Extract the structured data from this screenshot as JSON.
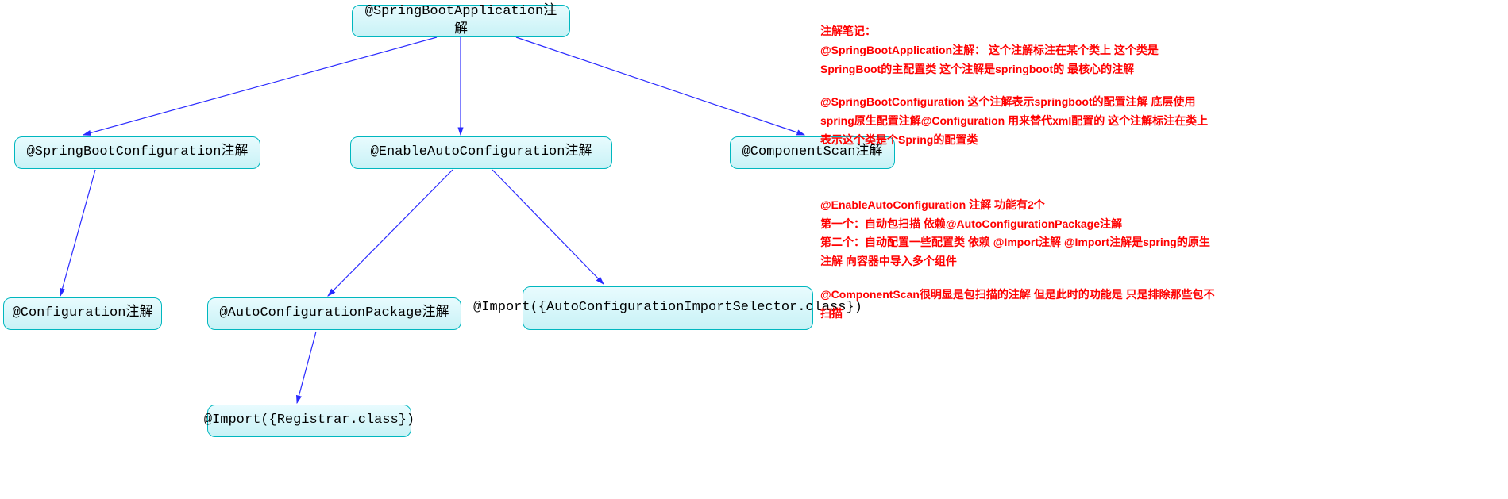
{
  "chart_data": {
    "type": "tree",
    "nodes": [
      {
        "id": "root",
        "label": "@SpringBootApplication注解"
      },
      {
        "id": "sbc",
        "label": "@SpringBootConfiguration注解"
      },
      {
        "id": "eac",
        "label": "@EnableAutoConfiguration注解"
      },
      {
        "id": "cs",
        "label": "@ComponentScan注解"
      },
      {
        "id": "conf",
        "label": "@Configuration注解"
      },
      {
        "id": "acp",
        "label": "@AutoConfigurationPackage注解"
      },
      {
        "id": "imp_sel",
        "label": "@Import({AutoConfigurationImportSelector.class})"
      },
      {
        "id": "imp_reg",
        "label": "@Import({Registrar.class})"
      }
    ],
    "edges": [
      {
        "from": "root",
        "to": "sbc"
      },
      {
        "from": "root",
        "to": "eac"
      },
      {
        "from": "root",
        "to": "cs"
      },
      {
        "from": "sbc",
        "to": "conf"
      },
      {
        "from": "eac",
        "to": "acp"
      },
      {
        "from": "eac",
        "to": "imp_sel"
      },
      {
        "from": "acp",
        "to": "imp_reg"
      }
    ]
  },
  "nodes": {
    "root": {
      "label": "@SpringBootApplication注解"
    },
    "sbc": {
      "label": "@SpringBootConfiguration注解"
    },
    "eac": {
      "label": "@EnableAutoConfiguration注解"
    },
    "cs": {
      "label": "@ComponentScan注解"
    },
    "conf": {
      "label": "@Configuration注解"
    },
    "acp": {
      "label": "@AutoConfigurationPackage注解"
    },
    "imp_sel": {
      "label": "@Import({AutoConfigurationImportSelector.class})"
    },
    "imp_reg": {
      "label": "@Import({Registrar.class})"
    }
  },
  "notes": {
    "p1": {
      "l1": "注解笔记：",
      "l2": "@SpringBootApplication注解： 这个注解标注在某个类上 这个类是SpringBoot的主配置类   这个注解是springboot的 最核心的注解"
    },
    "p2": {
      "l1": "@SpringBootConfiguration 这个注解表示springboot的配置注解 底层使用spring原生配置注解@Configuration   用来替代xml配置的   这个注解标注在类上 表示这个类是个Spring的配置类"
    },
    "p3": {
      "l1": "@EnableAutoConfiguration 注解   功能有2个",
      "l2": "第一个：自动包扫描   依赖@AutoConfigurationPackage注解",
      "l3": "第二个：自动配置一些配置类 依赖 @Import注解   @Import注解是spring的原生注解 向容器中导入多个组件"
    },
    "p4": {
      "l1": "@ComponentScan很明显是包扫描的注解 但是此时的功能是 只是排除那些包不扫描"
    }
  }
}
